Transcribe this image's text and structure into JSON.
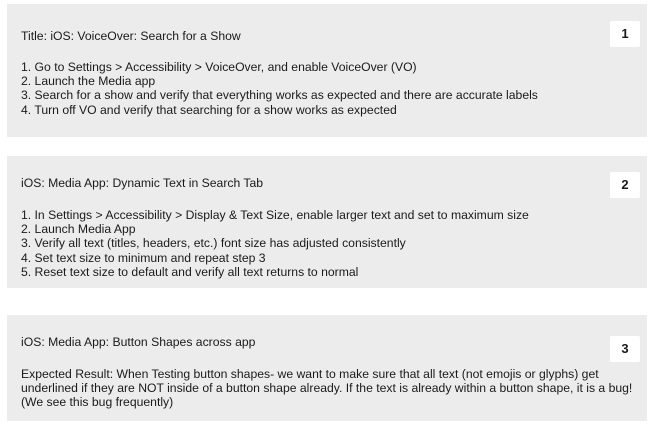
{
  "cards": [
    {
      "title": "Title: iOS: VoiceOver: Search for a Show",
      "number": "1",
      "steps": [
        "1. Go to Settings > Accessibility > VoiceOver, and enable VoiceOver (VO)",
        "2. Launch the Media app",
        "3. Search for a show and verify that everything works as expected and there are accurate labels",
        "4. Turn off VO and verify that searching for a show works as expected"
      ]
    },
    {
      "title": "iOS: Media App: Dynamic Text in Search Tab",
      "number": "2",
      "steps": [
        "1. In Settings > Accessibility > Display & Text Size, enable larger text and set to maximum size",
        "2. Launch Media App",
        "3. Verify all text (titles, headers, etc.) font size has adjusted consistently",
        "4. Set text size to minimum and repeat step 3",
        "5. Reset text size to default and verify all text returns to normal"
      ]
    },
    {
      "title": "iOS: Media App: Button Shapes across app",
      "number": "3",
      "body": "Expected Result: When Testing button shapes- we want to make sure that all text (not emojis or glyphs) get underlined if they are NOT inside of a button shape already. If the text is already within a button shape, it is a bug! (We see this bug frequently)"
    }
  ]
}
